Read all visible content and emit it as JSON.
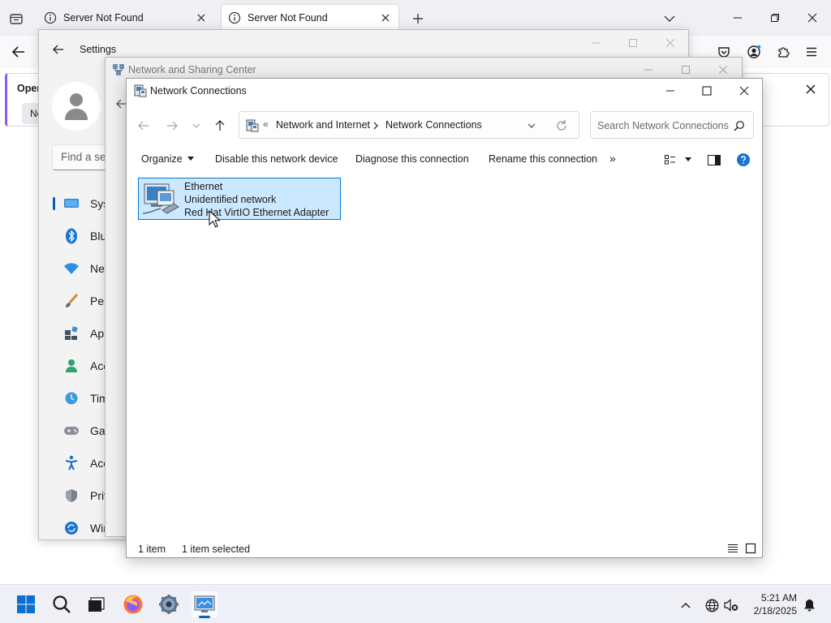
{
  "browser": {
    "tabs": [
      {
        "title": "Server Not Found",
        "active": false
      },
      {
        "title": "Server Not Found",
        "active": true
      }
    ],
    "notification": {
      "title": "Open",
      "button_label": "Not"
    },
    "accent": "#8a5cf5"
  },
  "settings": {
    "title": "Settings",
    "search_placeholder": "Find a se",
    "sidebar": [
      {
        "label": "Syst",
        "icon": "system-icon",
        "selected": true
      },
      {
        "label": "Blue",
        "icon": "bluetooth-icon"
      },
      {
        "label": "Net",
        "icon": "network-icon"
      },
      {
        "label": "Pers",
        "icon": "personalization-brush-icon"
      },
      {
        "label": "App",
        "icon": "apps-icon"
      },
      {
        "label": "Acc",
        "icon": "accounts-icon"
      },
      {
        "label": "Tim",
        "icon": "time-language-icon"
      },
      {
        "label": "Gar",
        "icon": "gaming-icon"
      },
      {
        "label": "Acc",
        "icon": "accessibility-icon"
      },
      {
        "label": "Priv",
        "icon": "privacy-shield-icon"
      },
      {
        "label": "Win",
        "icon": "windows-update-icon"
      }
    ]
  },
  "nsc": {
    "title": "Network and Sharing Center"
  },
  "nc": {
    "title": "Network Connections",
    "breadcrumb_prefix": "«",
    "breadcrumbs": [
      "Network and Internet",
      "Network Connections"
    ],
    "search_placeholder": "Search Network Connections",
    "commands": {
      "organize": "Organize",
      "disable": "Disable this network device",
      "diagnose": "Diagnose this connection",
      "rename": "Rename this connection",
      "more": "»"
    },
    "item": {
      "name": "Ethernet",
      "status": "Unidentified network",
      "adapter": "Red Hat VirtIO Ethernet Adapter"
    },
    "status_count": "1 item",
    "status_selected": "1 item selected"
  },
  "taskbar": {
    "time": "5:21 AM",
    "date": "2/18/2025",
    "accent": "#0067c0"
  }
}
